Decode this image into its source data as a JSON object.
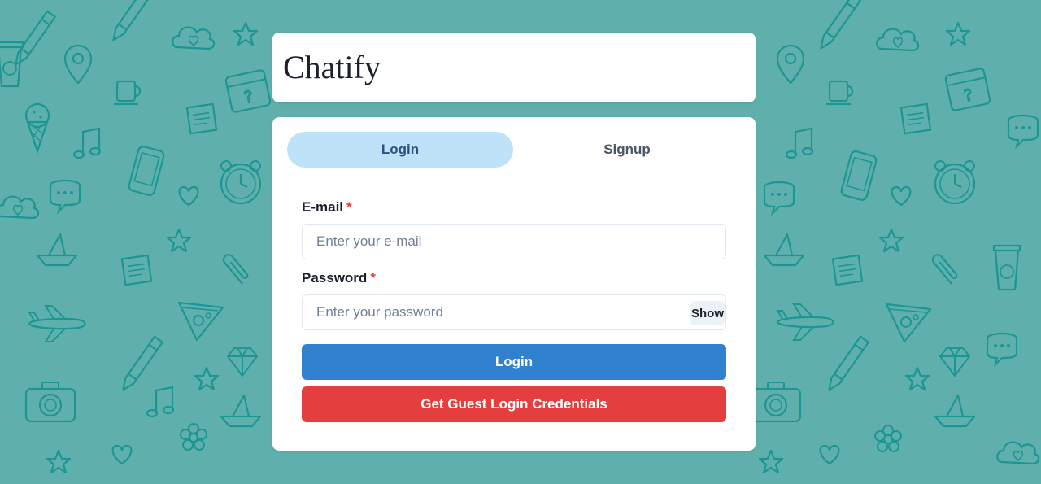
{
  "app": {
    "title": "Chatify"
  },
  "colors": {
    "background": "#5fb0ad",
    "pattern_stroke": "#1d9693",
    "active_tab": "#bee3f8",
    "primary_button": "#3182ce",
    "guest_button": "#e53e3e",
    "required_marker": "#e53e3e"
  },
  "tabs": [
    {
      "label": "Login",
      "active": true
    },
    {
      "label": "Signup",
      "active": false
    }
  ],
  "form": {
    "email": {
      "label": "E-mail",
      "required_marker": "*",
      "value": "",
      "placeholder": "Enter your e-mail"
    },
    "password": {
      "label": "Password",
      "required_marker": "*",
      "value": "",
      "placeholder": "Enter your password",
      "toggle_label": "Show"
    },
    "submit_label": "Login",
    "guest_label": "Get Guest Login Credentials"
  },
  "background_icons": [
    "pencil-icon",
    "heart-icon",
    "star-icon",
    "location-pin-icon",
    "coffee-cup-icon",
    "calendar-icon",
    "music-note-icon",
    "smartphone-icon",
    "alarm-clock-icon",
    "chat-bubble-icon",
    "paper-boat-icon",
    "paperclip-icon",
    "pizza-icon",
    "airplane-icon",
    "diamond-icon",
    "camera-icon",
    "ice-cream-icon",
    "flower-icon"
  ]
}
